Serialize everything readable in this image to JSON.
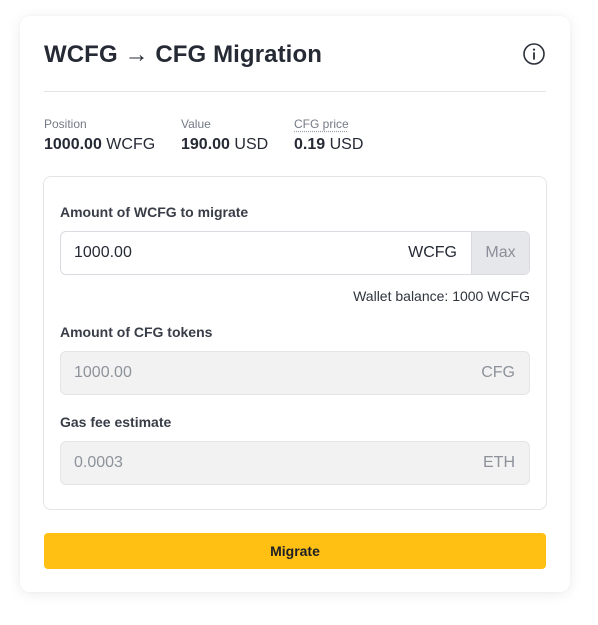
{
  "card": {
    "title": "WCFG → CFG Migration",
    "info_icon": "info-circle-icon"
  },
  "stats": [
    {
      "label": "Position",
      "value": "1000.00",
      "unit": "WCFG"
    },
    {
      "label": "Value",
      "value": "190.00",
      "unit": "USD"
    },
    {
      "label": "CFG price",
      "value": "0.19",
      "unit": "USD"
    }
  ],
  "form": {
    "wcfg_amount": {
      "label": "Amount of WCFG to migrate",
      "value": "1000.00",
      "suffix": "WCFG",
      "max_label": "Max",
      "balance_text": "Wallet balance: 1000 WCFG"
    },
    "cfg_amount": {
      "label": "Amount of CFG tokens",
      "value": "1000.00",
      "suffix": "CFG"
    },
    "gas_fee": {
      "label": "Gas fee estimate",
      "value": "0.0003",
      "suffix": "ETH"
    }
  },
  "actions": {
    "migrate_label": "Migrate"
  },
  "colors": {
    "accent": "#ffc013",
    "text": "#252a34",
    "muted": "#747a86",
    "border": "#e3e4e8",
    "disabled_bg": "#f2f2f2"
  }
}
